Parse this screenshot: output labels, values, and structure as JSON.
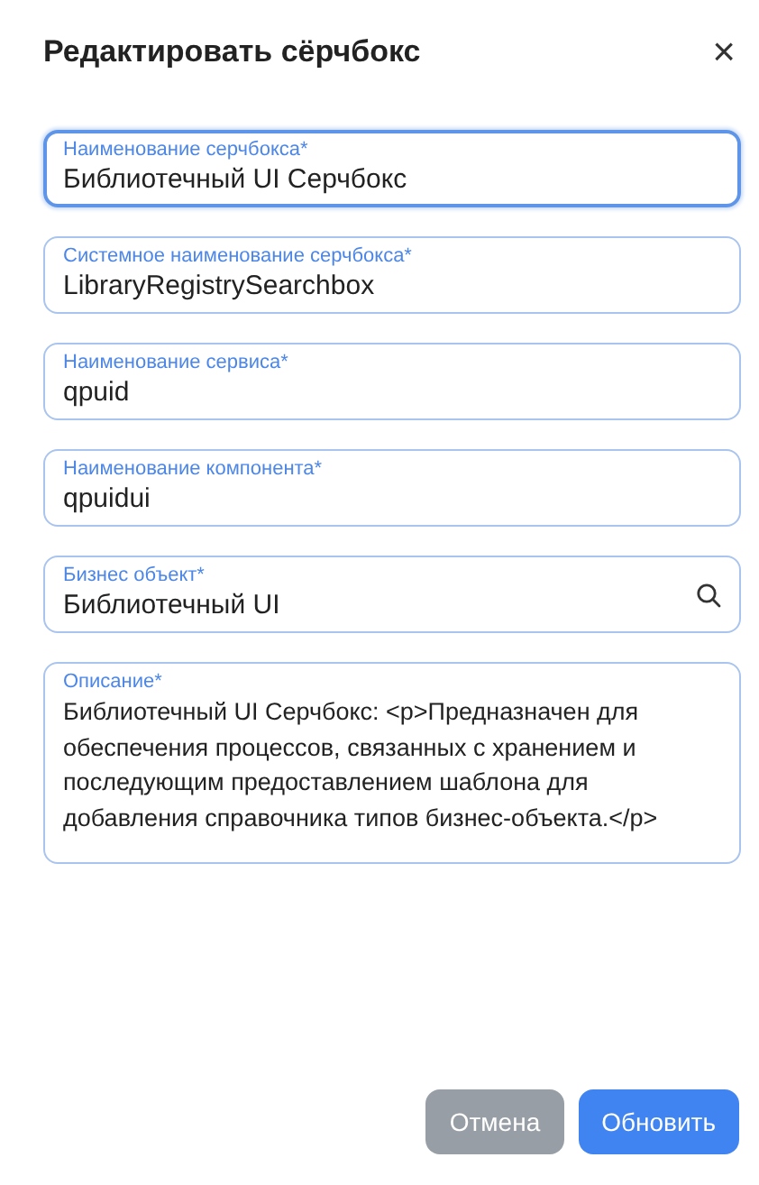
{
  "dialog": {
    "title": "Редактировать сёрчбокс",
    "close": "×"
  },
  "fields": [
    {
      "kind": "text",
      "label": "Наименование серчбокса*",
      "value": "Библиотечный UI Серчбокс",
      "focused": true
    },
    {
      "kind": "text",
      "label": "Системное наименование серчбокса*",
      "value": "LibraryRegistrySearchbox",
      "focused": false
    },
    {
      "kind": "text",
      "label": "Наименование сервиса*",
      "value": "qpuid",
      "focused": false
    },
    {
      "kind": "text",
      "label": "Наименование компонента*",
      "value": "qpuidui",
      "focused": false
    },
    {
      "kind": "lookup",
      "label": "Бизнес объект*",
      "value": "Библиотечный UI",
      "focused": false
    },
    {
      "kind": "textarea",
      "label": "Описание*",
      "value": "Библиотечный UI Серчбокс: <p>Предназначен для обеспечения процессов, связанных с хранением и последующим предоставлением шаблона для добавления справочника типов бизнес-объекта.</p>",
      "focused": false
    }
  ],
  "buttons": [
    {
      "label": "Отмена",
      "kind": "secondary"
    },
    {
      "label": "Обновить",
      "kind": "primary"
    }
  ]
}
